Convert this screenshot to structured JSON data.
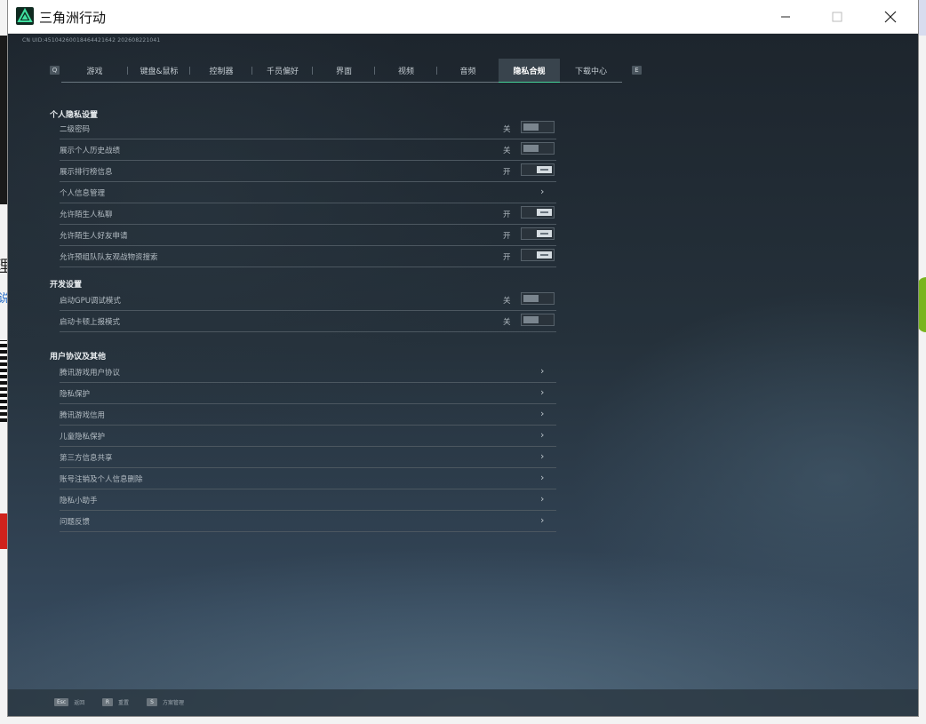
{
  "window": {
    "title": "三角洲行动"
  },
  "uid": "CN UID:451042600184644216​42 20260822​1041",
  "tabs": {
    "left_key": "Q",
    "right_key": "E",
    "items": [
      {
        "label": "游戏",
        "active": false
      },
      {
        "label": "键盘&鼠标",
        "active": false
      },
      {
        "label": "控制器",
        "active": false
      },
      {
        "label": "千员偏好",
        "active": false
      },
      {
        "label": "界面",
        "active": false
      },
      {
        "label": "视频",
        "active": false
      },
      {
        "label": "音频",
        "active": false
      },
      {
        "label": "隐私合规",
        "active": true
      },
      {
        "label": "下载中心",
        "active": false
      }
    ]
  },
  "sections": {
    "personal": {
      "title": "个人隐私设置",
      "rows": [
        {
          "label": "二级密码",
          "state": "关",
          "type": "toggle",
          "on": false
        },
        {
          "label": "展示个人历史战绩",
          "state": "关",
          "type": "toggle",
          "on": false
        },
        {
          "label": "展示排行榜信息",
          "state": "开",
          "type": "toggle",
          "on": true
        },
        {
          "label": "个人信息管理",
          "type": "link"
        },
        {
          "label": "允许陌生人私聊",
          "state": "开",
          "type": "toggle",
          "on": true
        },
        {
          "label": "允许陌生人好友申请",
          "state": "开",
          "type": "toggle",
          "on": true
        },
        {
          "label": "允许预组队队友观战物资搜索",
          "state": "开",
          "type": "toggle",
          "on": true
        }
      ]
    },
    "dev": {
      "title": "开发设置",
      "rows": [
        {
          "label": "启动GPU调试模式",
          "state": "关",
          "type": "toggle",
          "on": false
        },
        {
          "label": "启动卡顿上报模式",
          "state": "关",
          "type": "toggle",
          "on": false
        }
      ]
    },
    "agreements": {
      "title": "用户协议及其他",
      "rows": [
        {
          "label": "腾讯游戏用户协议",
          "type": "link"
        },
        {
          "label": "隐私保护",
          "type": "link"
        },
        {
          "label": "腾讯游戏信用",
          "type": "link"
        },
        {
          "label": "儿童隐私保护",
          "type": "link"
        },
        {
          "label": "第三方信息共享",
          "type": "link"
        },
        {
          "label": "账号注销及个人信息删除",
          "type": "link"
        },
        {
          "label": "隐私小助手",
          "type": "link"
        },
        {
          "label": "问题反馈",
          "type": "link"
        }
      ]
    }
  },
  "bottom_hints": [
    {
      "key": "Esc",
      "label": "返回"
    },
    {
      "key": "R",
      "label": "重置"
    },
    {
      "key": "S",
      "label": "方案管理"
    }
  ],
  "icons": {
    "app": "delta-force-logo-icon",
    "minimize": "minimize-icon",
    "maximize": "maximize-icon",
    "close": "close-icon",
    "chevron": "chevron-right-icon"
  },
  "colors": {
    "accent": "#47d49a",
    "panel_bg": "#1e2730",
    "text": "#b3bcc3"
  }
}
